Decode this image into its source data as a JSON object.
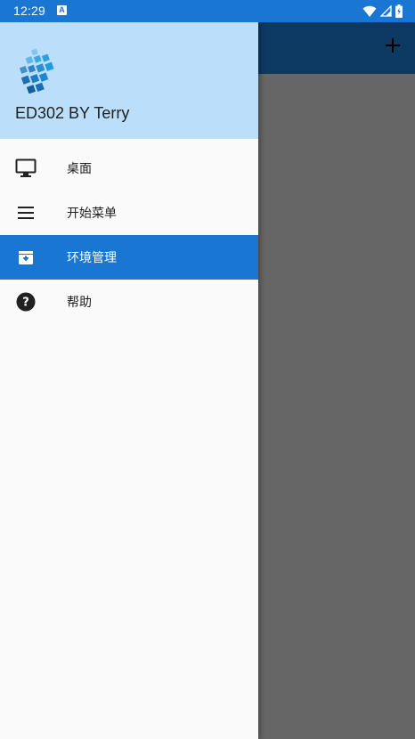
{
  "status_bar": {
    "time": "12:29",
    "notification_glyph": "A",
    "icons": [
      "wifi-icon",
      "signal-icon",
      "battery-icon"
    ],
    "background": "#1976d2"
  },
  "app_toolbar": {
    "add_icon": "plus-icon",
    "background": "#0d3a62"
  },
  "drawer": {
    "header": {
      "title": "ED302 BY Terry",
      "logo": "blocks-logo-icon",
      "background": "#bbdefb"
    },
    "menu": [
      {
        "label": "桌面",
        "icon": "monitor-icon",
        "active": false
      },
      {
        "label": "开始菜单",
        "icon": "menu-icon",
        "active": false
      },
      {
        "label": "环境管理",
        "icon": "archive-icon",
        "active": true
      },
      {
        "label": "帮助",
        "icon": "help-circle-icon",
        "active": false
      }
    ],
    "active_color": "#1976d2"
  }
}
